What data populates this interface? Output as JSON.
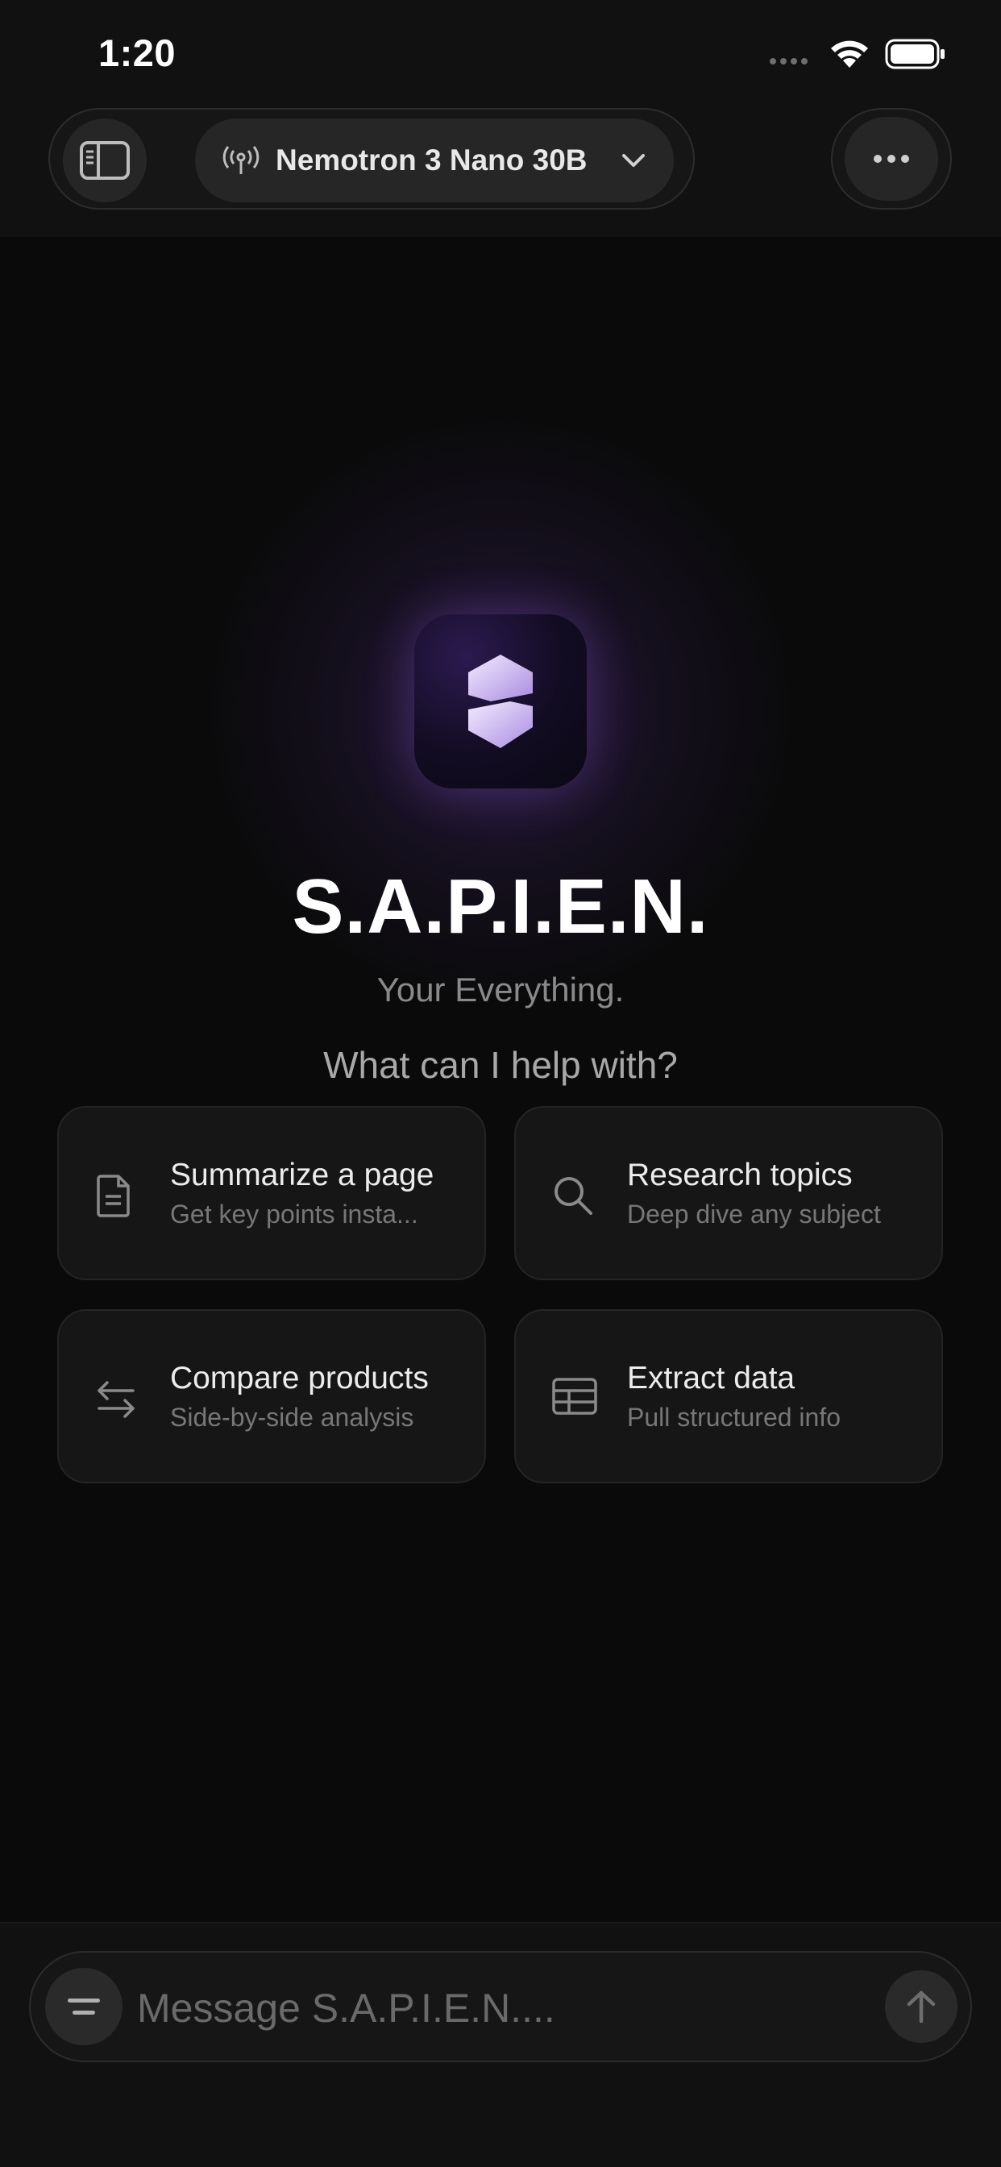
{
  "status_bar": {
    "time": "1:20"
  },
  "header": {
    "model_name": "Nemotron 3 Nano 30B"
  },
  "hero": {
    "title": "S.A.P.I.E.N.",
    "tagline": "Your Everything.",
    "prompt": "What can I help with?"
  },
  "suggestions": [
    {
      "title": "Summarize a page",
      "subtitle": "Get key points insta...",
      "icon": "document-icon"
    },
    {
      "title": "Research topics",
      "subtitle": "Deep dive any subject",
      "icon": "search-icon"
    },
    {
      "title": "Compare products",
      "subtitle": "Side-by-side analysis",
      "icon": "compare-arrows-icon"
    },
    {
      "title": "Extract data",
      "subtitle": "Pull structured info",
      "icon": "table-icon"
    }
  ],
  "composer": {
    "placeholder": "Message S.A.P.I.E.N...."
  },
  "colors": {
    "background": "#0a0a0a",
    "card": "#161616",
    "accent_glow": "#7846c8"
  }
}
